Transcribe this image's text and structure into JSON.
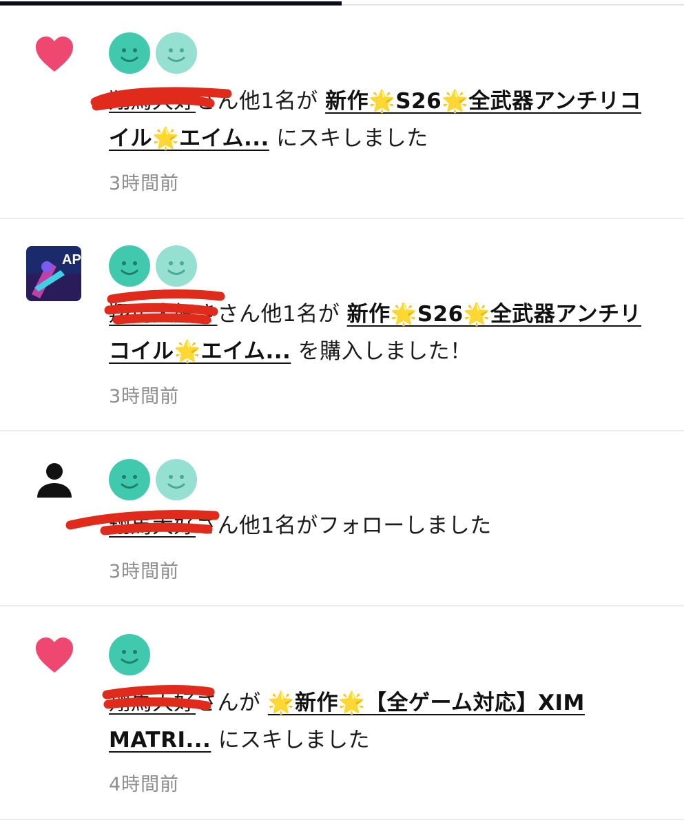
{
  "colors": {
    "heart": "#ee4770",
    "avatar_primary": "#41c9ae",
    "avatar_secondary": "#95e0d1",
    "redaction": "#e02a1b",
    "time": "#8d8d8d"
  },
  "notifications": [
    {
      "type_icon": "heart-icon",
      "user_name": "翔馬大好",
      "actor_suffix": "さん他1名が",
      "article_title": "新作🌟S26🌟全武器アンチリコイル🌟エイム...",
      "action": "にスキしました",
      "time": "3時間前"
    },
    {
      "type_icon": "article-thumbnail",
      "thumbnail_text": "AP",
      "user_name": "翔馬大好き",
      "actor_suffix": "さん他1名が",
      "article_title": "新作🌟S26🌟全武器アンチリコイル🌟エイム...",
      "action": "を購入しました！",
      "time": "3時間前"
    },
    {
      "type_icon": "person-icon",
      "user_name": "翔馬大好",
      "actor_suffix": "さん他1名がフォローしました",
      "time": "3時間前"
    },
    {
      "type_icon": "heart-icon",
      "user_name": "翔馬大好",
      "actor_suffix": "さんが",
      "article_title": "🌟新作🌟【全ゲーム対応】XIM MATRI...",
      "action": "にスキしました",
      "time": "4時間前"
    }
  ]
}
